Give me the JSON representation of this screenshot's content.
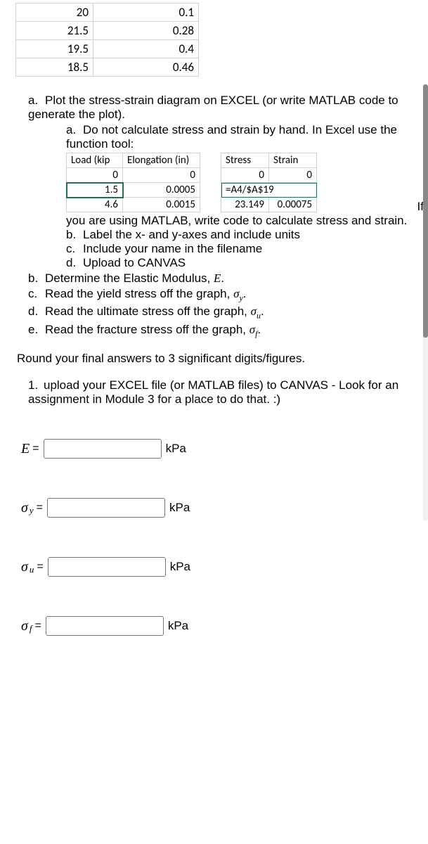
{
  "top_table": {
    "rows": [
      {
        "c1": "20",
        "c2": "0.1"
      },
      {
        "c1": "21.5",
        "c2": "0.28"
      },
      {
        "c1": "19.5",
        "c2": "0.4"
      },
      {
        "c1": "18.5",
        "c2": "0.46"
      }
    ]
  },
  "q_a": {
    "marker": "a.",
    "text": "Plot the stress-strain diagram on EXCEL (or write MATLAB code to generate the plot).",
    "sub_a_marker": "a.",
    "sub_a_text1": "Do not calculate stress and strain by hand. In Excel use the function tool:",
    "sub_a_after": "you are using MATLAB, write code to calculate stress and strain.",
    "if_word": "If",
    "sub_b_marker": "b.",
    "sub_b_text": "Label the x- and y-axes and include units",
    "sub_c_marker": "c.",
    "sub_c_text": "Include your name in the filename",
    "sub_d_marker": "d.",
    "sub_d_text": "Upload to CANVAS"
  },
  "excel": {
    "h1": "Load (kip",
    "h2": "Elongation (in)",
    "h3": "Stress",
    "h4": "Strain",
    "r1": {
      "a": "0",
      "b": "0",
      "c": "0",
      "d": "0"
    },
    "r2": {
      "a": "1.5",
      "b": "0.0005",
      "c": "=A4/$A$19",
      "d": ""
    },
    "r3": {
      "a": "4.6",
      "b": "0.0015",
      "c": "23.149",
      "d": "0.00075"
    }
  },
  "q_b": {
    "marker": "b.",
    "text_pre": "Determine the Elastic Modulus, ",
    "sym": "E",
    "text_post": "."
  },
  "q_c": {
    "marker": "c.",
    "text_pre": "Read the yield stress off the graph, ",
    "sym": "σ",
    "sub": "y",
    "text_post": "."
  },
  "q_d": {
    "marker": "d.",
    "text_pre": "Read the ultimate stress off the graph, ",
    "sym": "σ",
    "sub": "u",
    "text_post": "."
  },
  "q_e": {
    "marker": "e.",
    "text_pre": "Read the fracture stress off the graph, ",
    "sym": "σ",
    "sub": "f",
    "text_post": "."
  },
  "round_note": "Round your final answers to 3 significant digits/figures.",
  "upload": {
    "marker": "1.",
    "text": "upload your EXCEL file (or MATLAB files) to CANVAS - Look for an assignment in Module 3 for a place to do that. :)"
  },
  "answers": {
    "E": {
      "sym": "E",
      "sub": "",
      "unit": "kPa"
    },
    "sy": {
      "sym": "σ",
      "sub": "y",
      "unit": "kPa"
    },
    "su": {
      "sym": "σ",
      "sub": "u",
      "unit": "kPa"
    },
    "sf": {
      "sym": "σ",
      "sub": "f",
      "unit": "kPa"
    }
  }
}
